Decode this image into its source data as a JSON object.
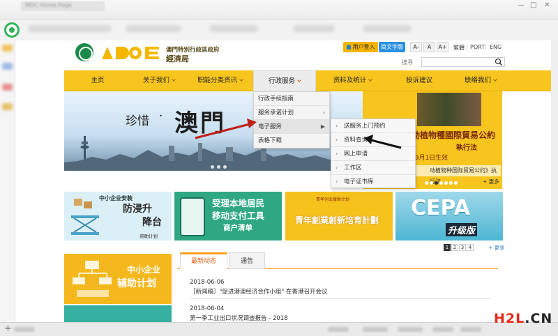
{
  "browser": {
    "tab_title": "MDC Home Page",
    "window_controls": [
      "—",
      "□",
      "✕"
    ]
  },
  "header": {
    "org_name": "澳門特別行政區政府",
    "bureau_name": "經濟局",
    "login_label": "用户登入",
    "simplified_label": "简文字版",
    "font_sizes": [
      "A-",
      "A",
      "A+"
    ],
    "links": [
      "繁體",
      "PORT",
      "ENG"
    ],
    "search_label": "搜寻",
    "search_placeholder": ""
  },
  "nav": {
    "items": [
      {
        "label": "主页",
        "has_chevron": false
      },
      {
        "label": "关于我们",
        "has_chevron": true
      },
      {
        "label": "职能分类资讯",
        "has_chevron": true
      },
      {
        "label": "行政服务",
        "has_chevron": true,
        "active": true
      },
      {
        "label": "资料及统计",
        "has_chevron": true
      },
      {
        "label": "投诉建议",
        "has_chevron": false
      },
      {
        "label": "联络我们",
        "has_chevron": true
      }
    ]
  },
  "dropdown": {
    "items": [
      {
        "label": "行政手续指南",
        "has_submenu": false
      },
      {
        "label": "服务承诺计划",
        "has_submenu": true
      },
      {
        "label": "电子服务",
        "has_submenu": true,
        "hover": true
      },
      {
        "label": "表格下载",
        "has_submenu": false
      }
    ],
    "submenu": [
      {
        "label": "送服务上门预约"
      },
      {
        "label": "资料查询"
      },
      {
        "label": "网上申请"
      },
      {
        "label": "工作区"
      },
      {
        "label": "电子证书库"
      }
    ]
  },
  "banner": {
    "calligraphy_small": "珍惜",
    "calligraphy_dot": "·",
    "calligraphy_large": "澳門"
  },
  "cites": {
    "title": "動植物種國際貿易公約",
    "subtitle": "執行法",
    "date": "7年9月1日生效",
    "caption": "动植物种国际贸易公约》执行法",
    "more": "+ 更多"
  },
  "tiles": [
    {
      "lines": [
        "中小企业安装",
        "防浸升",
        "降台",
        "资助计划"
      ]
    },
    {
      "lines": [
        "受理本地居民",
        "移动支付工具",
        "商户清单"
      ]
    },
    {
      "lines": [
        "青年创业援助计划",
        "青年創業創新培育計劃"
      ]
    },
    {
      "lines": [
        "CEPA",
        "升级版"
      ]
    }
  ],
  "pager": {
    "pages": [
      "1",
      "2",
      "3",
      "4"
    ],
    "more": "+ 更多"
  },
  "sme": {
    "line1": "中小企业",
    "line2": "辅助计划"
  },
  "news": {
    "tabs": [
      "最新动态",
      "通告"
    ],
    "items": [
      {
        "date": "2018-06-06",
        "title": "［新闻稿］\"促进港澳经济合作小组\" 在香港召开会议"
      },
      {
        "date": "2018-06-04",
        "title": "第一季工业出口状况调查报告 - 2018"
      }
    ]
  },
  "watermark": {
    "brand": "H2L",
    "suffix": ".CN"
  },
  "colors": {
    "nav_yellow": "#f7c51d",
    "accent_orange": "#f5a01c",
    "link_blue": "#2a7fc4"
  }
}
